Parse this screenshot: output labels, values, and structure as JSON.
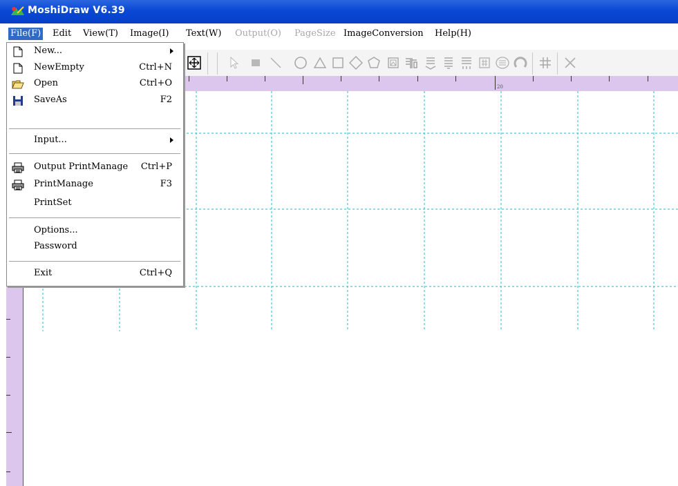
{
  "window": {
    "title": "MoshiDraw V6.39"
  },
  "menubar": {
    "items": [
      {
        "label": "File(F)",
        "state": "active"
      },
      {
        "label": "Edit",
        "state": "normal"
      },
      {
        "label": "View(T)",
        "state": "normal"
      },
      {
        "label": "Image(I)",
        "state": "normal"
      },
      {
        "label": "Text(W)",
        "state": "normal"
      },
      {
        "label": "Output(O)",
        "state": "disabled"
      },
      {
        "label": "PageSize",
        "state": "disabled"
      },
      {
        "label": "ImageConversion",
        "state": "normal"
      },
      {
        "label": "Help(H)",
        "state": "normal"
      }
    ]
  },
  "file_menu": {
    "items": [
      {
        "label": "New...",
        "shortcut": "",
        "icon": "new-document-icon",
        "submenu": true
      },
      {
        "label": "NewEmpty",
        "shortcut": "Ctrl+N",
        "icon": "new-document-icon",
        "submenu": false
      },
      {
        "label": "Open",
        "shortcut": "Ctrl+O",
        "icon": "open-folder-icon",
        "submenu": false
      },
      {
        "label": "SaveAs",
        "shortcut": "F2",
        "icon": "save-disk-icon",
        "submenu": false
      },
      {
        "label": "Input...",
        "shortcut": "",
        "icon": "",
        "submenu": true
      },
      {
        "label": "Output PrintManage",
        "shortcut": "Ctrl+P",
        "icon": "printer-icon",
        "submenu": false
      },
      {
        "label": "PrintManage",
        "shortcut": "F3",
        "icon": "printer-icon",
        "submenu": false
      },
      {
        "label": "PrintSet",
        "shortcut": "",
        "icon": "",
        "submenu": false
      },
      {
        "label": "Options...",
        "shortcut": "",
        "icon": "",
        "submenu": false
      },
      {
        "label": "Password",
        "shortcut": "",
        "icon": "",
        "submenu": false
      },
      {
        "label": "Exit",
        "shortcut": "Ctrl+Q",
        "icon": "",
        "submenu": false
      }
    ]
  },
  "toolbar": {
    "icons": [
      "fit-page-icon",
      "select-arrow-icon",
      "filled-rectangle-icon",
      "line-icon",
      "circle-icon",
      "triangle-icon",
      "square-icon",
      "diamond-icon",
      "hexagon-icon",
      "image-icon",
      "barcode-icon",
      "text-icon",
      "text-vertical-icon",
      "text-multiline-icon",
      "serial-number-icon",
      "emblem-icon",
      "arc-text-icon",
      "grid-icon",
      "delete-icon"
    ]
  },
  "ruler": {
    "label_20": "20"
  },
  "colors": {
    "titlebar": "#0a48d4",
    "menu_highlight": "#316ac5",
    "ruler": "#dcc6ee",
    "grid": "#4cc6d4",
    "disabled_text": "#a8a8a8"
  }
}
